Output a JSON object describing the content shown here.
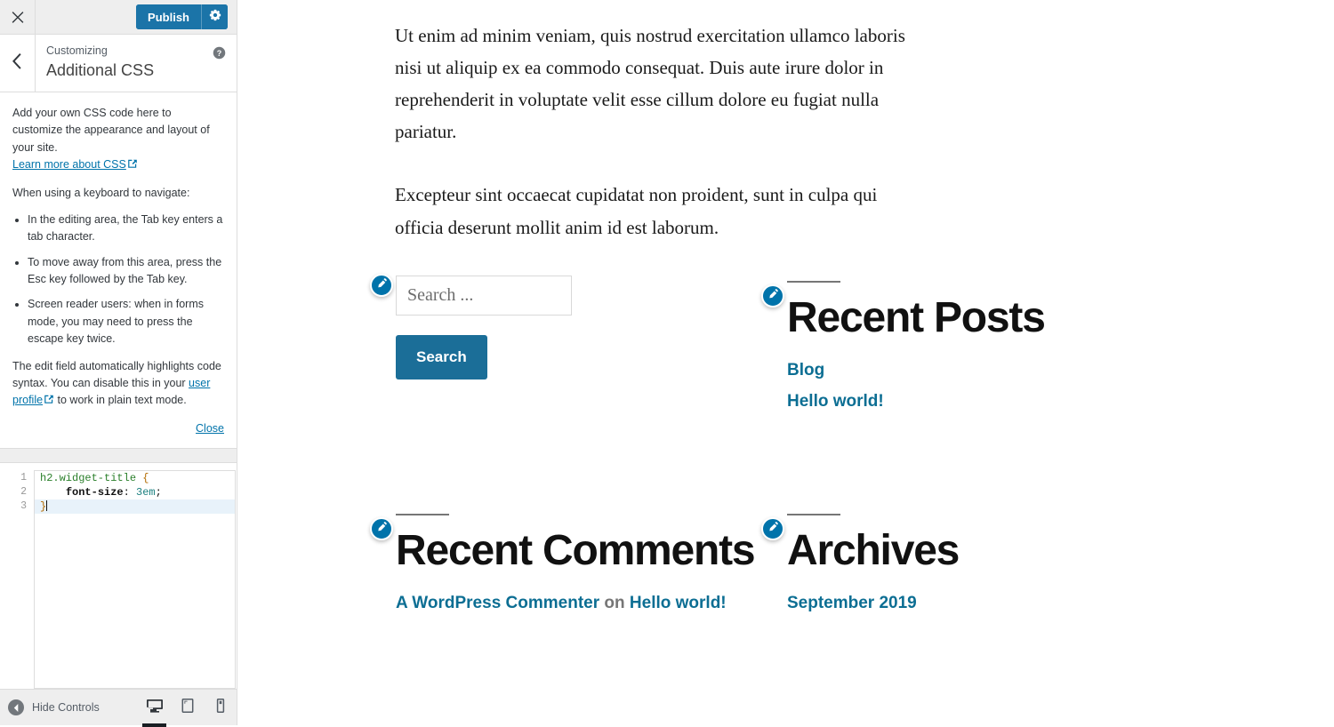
{
  "customizer": {
    "topbar": {
      "close_icon": "close-icon",
      "close_title": "Close the Customizer and go back to the previous page",
      "publish_label": "Publish",
      "gear_icon": "gear-icon"
    },
    "header": {
      "back_icon": "chevron-left-icon",
      "eyebrow": "Customizing",
      "title": "Additional CSS",
      "help_icon": "help-icon"
    },
    "help": {
      "intro": "Add your own CSS code here to customize the appearance and layout of your site.",
      "learn_more_link": "Learn more about CSS",
      "external_icon": "external-link-icon",
      "keyboard_heading": "When using a keyboard to navigate:",
      "bullets": [
        "In the editing area, the Tab key enters a tab character.",
        "To move away from this area, press the Esc key followed by the Tab key.",
        "Screen reader users: when in forms mode, you may need to press the escape key twice."
      ],
      "syntax_note_part1": "The edit field automatically highlights code syntax. You can disable this in your ",
      "syntax_note_link": "user profile",
      "syntax_note_part2": " to work in plain text mode.",
      "close_label": "Close"
    },
    "editor": {
      "line_numbers": [
        "1",
        "2",
        "3"
      ],
      "code": {
        "line1_selector": "h2.widget-title",
        "line1_brace": "{",
        "line2_property": "font-size",
        "line2_colon": ":",
        "line2_value": "3em",
        "line2_semicolon": ";",
        "line3_brace": "}"
      },
      "active_line": 3
    },
    "footer": {
      "collapse_icon": "collapse-arrow-icon",
      "collapse_label": "Hide Controls",
      "devices": [
        {
          "name": "desktop",
          "icon": "desktop-icon",
          "active": true
        },
        {
          "name": "tablet",
          "icon": "tablet-icon",
          "active": false
        },
        {
          "name": "mobile",
          "icon": "mobile-icon",
          "active": false
        }
      ]
    }
  },
  "preview": {
    "entry_paragraphs": [
      "Ut enim ad minim veniam, quis nostrud exercitation ullamco laboris nisi ut aliquip ex ea commodo consequat. Duis aute irure dolor in reprehenderit in voluptate velit esse cillum dolore eu fugiat nulla pariatur.",
      "Excepteur sint occaecat cupidatat non proident, sunt in culpa qui officia deserunt mollit anim id est laborum."
    ],
    "widgets": {
      "search": {
        "edit_icon": "pencil-edit-icon",
        "placeholder": "Search ...",
        "value": "",
        "submit_label": "Search"
      },
      "recent_posts": {
        "edit_icon": "pencil-edit-icon",
        "title": "Recent Posts",
        "items": [
          "Blog",
          "Hello world!"
        ]
      },
      "recent_comments": {
        "edit_icon": "pencil-edit-icon",
        "title": "Recent Comments",
        "comment_author": "A WordPress Commenter",
        "comment_on": " on ",
        "comment_post": "Hello world!"
      },
      "archives": {
        "edit_icon": "pencil-edit-icon",
        "title": "Archives",
        "items": [
          "September 2019"
        ]
      }
    }
  },
  "colors": {
    "wp_blue": "#0073aa",
    "publish_blue": "#1b74a8",
    "link_blue": "#0c6e93",
    "sidebar_bg": "#eeeeee",
    "border": "#dddddd"
  }
}
